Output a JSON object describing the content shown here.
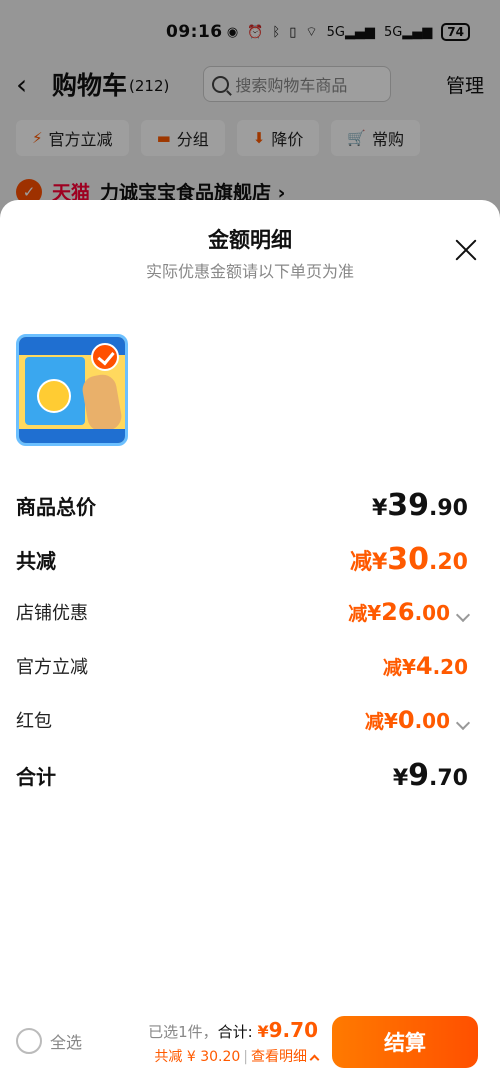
{
  "status_bar": {
    "time": "09:16",
    "icons": [
      "eye-icon",
      "alarm-icon",
      "bluetooth-icon",
      "vibrate-icon",
      "wifi-icon",
      "signal-5g-icon",
      "signal-5g-icon"
    ],
    "signal1_label": "5G",
    "signal2_label": "5G",
    "battery": "74"
  },
  "cart_header": {
    "title": "购物车",
    "count": "(212)",
    "search_placeholder": "搜索购物车商品",
    "manage_label": "管理"
  },
  "filters": [
    {
      "label": "官方立减",
      "icon": "lightning-icon"
    },
    {
      "label": "分组",
      "icon": "folder-icon"
    },
    {
      "label": "降价",
      "icon": "down-arrow-icon"
    },
    {
      "label": "常购",
      "icon": "cart-icon"
    }
  ],
  "store": {
    "platform": "天猫",
    "name": "力诚宝宝食品旗舰店 ›"
  },
  "sheet": {
    "title": "金额明细",
    "subtitle": "实际优惠金额请以下单页为准",
    "rows": [
      {
        "label": "商品总价",
        "prefix": "",
        "yen": "¥",
        "int": "39",
        "dec": ".90"
      },
      {
        "label": "共减",
        "prefix": "减",
        "yen": "¥",
        "int": "30",
        "dec": ".20"
      },
      {
        "label": "店铺优惠",
        "prefix": "减",
        "yen": "¥",
        "int": "26",
        "dec": ".00"
      },
      {
        "label": "官方立减",
        "prefix": "减",
        "yen": "¥",
        "int": "4",
        "dec": ".20"
      },
      {
        "label": "红包",
        "prefix": "减",
        "yen": "¥",
        "int": "0",
        "dec": ".00"
      },
      {
        "label": "合计",
        "prefix": "",
        "yen": "¥",
        "int": "9",
        "dec": ".70"
      }
    ]
  },
  "bottom_bar": {
    "select_all_label": "全选",
    "selected_text": "已选1件，",
    "total_label": "合计:",
    "total_yen": "¥",
    "total_value": "9.70",
    "discount_text": "共减 ¥ 30.20",
    "separator": "|",
    "detail_link": "查看明细",
    "checkout_label": "结算"
  },
  "colors": {
    "accent": "#ff5a00",
    "tmall_red": "#ff0036",
    "checkout_gradient_start": "#ff7a00",
    "checkout_gradient_end": "#ff5000"
  }
}
